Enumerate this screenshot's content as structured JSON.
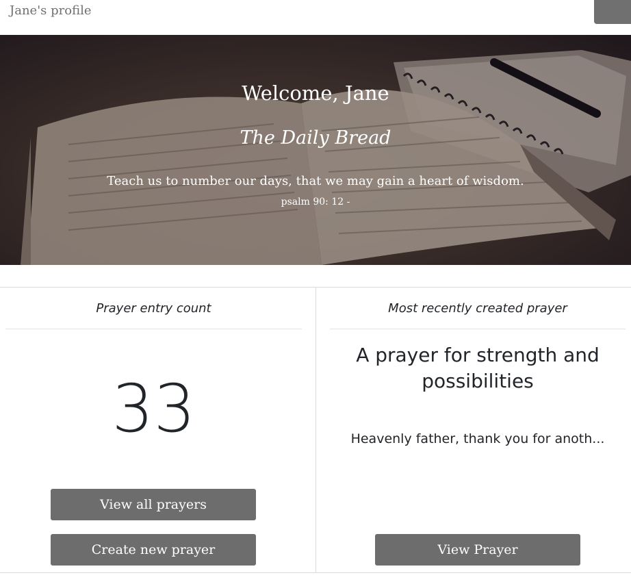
{
  "nav": {
    "brand": "Jane's profile"
  },
  "hero": {
    "title": "Welcome, Jane",
    "subtitle": "The Daily Bread",
    "verse": "Teach us to number our days, that we may gain a heart of wisdom.",
    "reference": "psalm 90: 12 -"
  },
  "count_card": {
    "header": "Prayer entry count",
    "count": "33",
    "view_all_label": "View all prayers",
    "create_label": "Create new prayer"
  },
  "recent_card": {
    "header": "Most recently created prayer",
    "title": "A prayer for strength and possibilities",
    "excerpt": "Heavenly father, thank you for anoth...",
    "view_label": "View Prayer"
  },
  "colors": {
    "button": "#6d6d6d",
    "nav_toggle": "#707070",
    "text": "#212529"
  }
}
